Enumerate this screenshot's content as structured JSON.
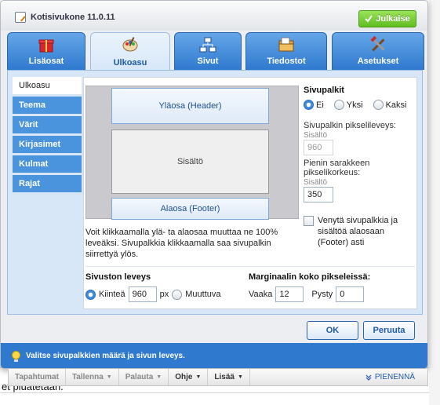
{
  "window": {
    "title": "Kotisivukone 11.0.11",
    "publish_label": "Julkaise"
  },
  "tabs": [
    {
      "label": "Lisäosat",
      "icon": "gift-icon"
    },
    {
      "label": "Ulkoasu",
      "icon": "palette-icon"
    },
    {
      "label": "Sivut",
      "icon": "sitemap-icon"
    },
    {
      "label": "Tiedostot",
      "icon": "files-icon"
    },
    {
      "label": "Asetukset",
      "icon": "tools-icon"
    }
  ],
  "sidebar": {
    "items": [
      {
        "label": "Ulkoasu"
      },
      {
        "label": "Teema"
      },
      {
        "label": "Värit"
      },
      {
        "label": "Kirjasimet"
      },
      {
        "label": "Kulmat"
      },
      {
        "label": "Rajat"
      }
    ]
  },
  "preview": {
    "header": "Yläosa (Header)",
    "content": "Sisältö",
    "footer": "Alaosa (Footer)",
    "hint": "Voit klikkaamalla ylä- ta alaosaa muuttaa ne 100% leveäksi. Sivupalkkia klikkaamalla saa sivupalkin siirrettyä ylös."
  },
  "sidebars": {
    "title": "Sivupalkit",
    "options": [
      "Ei",
      "Yksi",
      "Kaksi"
    ],
    "selected": "Ei",
    "width_label": "Sivupalkin pikselileveys:",
    "width_sub": "Sisältö",
    "width_value": "960",
    "min_height_label": "Pienin sarakkeen pikselikorkeus:",
    "min_height_sub": "Sisältö",
    "min_height_value": "350",
    "stretch_label": "Venytä sivupalkkia ja sisältöä alaosaan (Footer) asti",
    "stretch_checked": false
  },
  "site_width": {
    "title": "Sivuston leveys",
    "fixed_label": "Kiinteä",
    "fixed_value": "960",
    "unit": "px",
    "variable_label": "Muuttuva",
    "selected": "Kiinteä"
  },
  "margins": {
    "title": "Marginaalin koko pikseleissä:",
    "horizontal_label": "Vaaka",
    "horizontal_value": "12",
    "vertical_label": "Pysty",
    "vertical_value": "0"
  },
  "buttons": {
    "ok": "OK",
    "cancel": "Peruuta"
  },
  "status": {
    "message": "Valitse sivupalkkien määrä ja sivun leveys."
  },
  "toolbar": {
    "items": [
      "Tapahtumat",
      "Tallenna",
      "Palauta",
      "Ohje",
      "Lisää"
    ],
    "minimize": "PIENENNÄ"
  },
  "background": {
    "text": "et piuatetaan."
  },
  "colors": {
    "accent": "#2f79cf",
    "publish": "#5ebd1e",
    "panel": "#d7e7f8",
    "brand_strip": "#a71930"
  }
}
